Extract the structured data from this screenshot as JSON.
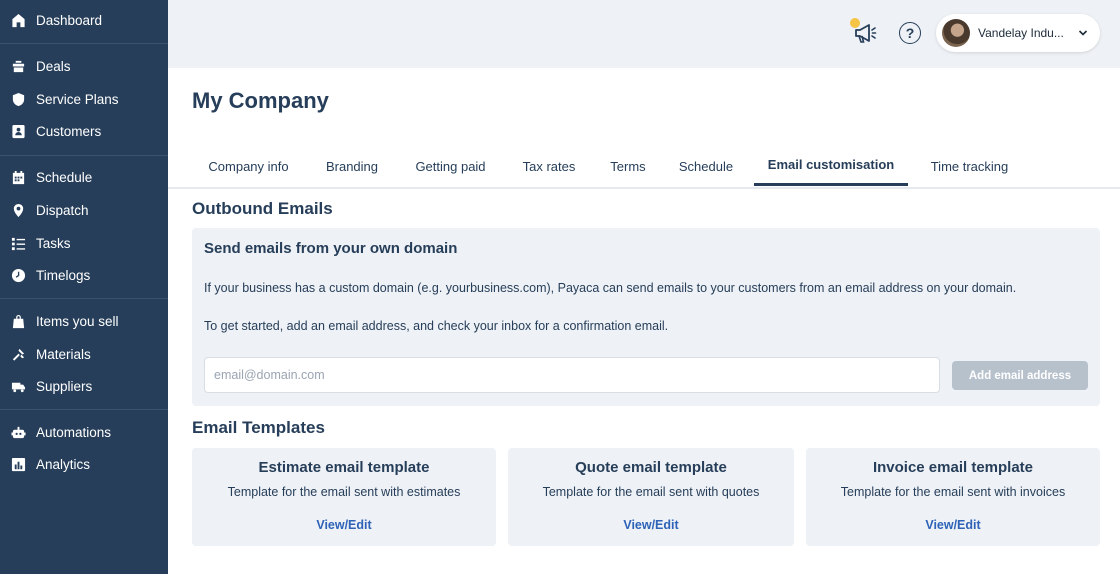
{
  "sidebar": {
    "items": [
      {
        "label": "Dashboard",
        "icon": "home-icon"
      },
      {
        "label": "Deals",
        "icon": "deals-icon"
      },
      {
        "label": "Service Plans",
        "icon": "shield-icon"
      },
      {
        "label": "Customers",
        "icon": "customers-icon"
      },
      {
        "label": "Schedule",
        "icon": "calendar-icon"
      },
      {
        "label": "Dispatch",
        "icon": "map-pin-icon"
      },
      {
        "label": "Tasks",
        "icon": "list-icon"
      },
      {
        "label": "Timelogs",
        "icon": "clock-icon"
      },
      {
        "label": "Items you sell",
        "icon": "shopping-bag-icon"
      },
      {
        "label": "Materials",
        "icon": "tools-icon"
      },
      {
        "label": "Suppliers",
        "icon": "truck-icon"
      },
      {
        "label": "Automations",
        "icon": "robot-icon"
      },
      {
        "label": "Analytics",
        "icon": "bar-chart-icon"
      }
    ]
  },
  "topbar": {
    "notification_count": "1",
    "account_name": "Vandelay Indu..."
  },
  "page": {
    "title": "My Company",
    "tabs": [
      {
        "label": "Company info",
        "active": false
      },
      {
        "label": "Branding",
        "active": false
      },
      {
        "label": "Getting paid",
        "active": false
      },
      {
        "label": "Tax rates",
        "active": false
      },
      {
        "label": "Terms",
        "active": false
      },
      {
        "label": "Schedule",
        "active": false
      },
      {
        "label": "Email customisation",
        "active": true
      },
      {
        "label": "Time tracking",
        "active": false
      }
    ]
  },
  "outbound": {
    "section_title": "Outbound Emails",
    "panel_title": "Send emails from your own domain",
    "description_1": "If your business has a custom domain (e.g. yourbusiness.com), Payaca can send emails to your customers from an email address on your domain.",
    "description_2": "To get started, add an email address, and check your inbox for a confirmation email.",
    "email_placeholder": "email@domain.com",
    "email_value": "",
    "add_button_label": "Add email address"
  },
  "templates": {
    "section_title": "Email Templates",
    "cards": [
      {
        "title": "Estimate email template",
        "description": "Template for the email sent with estimates",
        "link": "View/Edit"
      },
      {
        "title": "Quote email template",
        "description": "Template for the email sent with quotes",
        "link": "View/Edit"
      },
      {
        "title": "Invoice email template",
        "description": "Template for the email sent with invoices",
        "link": "View/Edit"
      }
    ]
  },
  "colors": {
    "sidebar_bg": "#263e59",
    "accent_link": "#2e63b8",
    "panel_bg": "#eef1f5",
    "button_disabled": "#b7c1cc"
  }
}
